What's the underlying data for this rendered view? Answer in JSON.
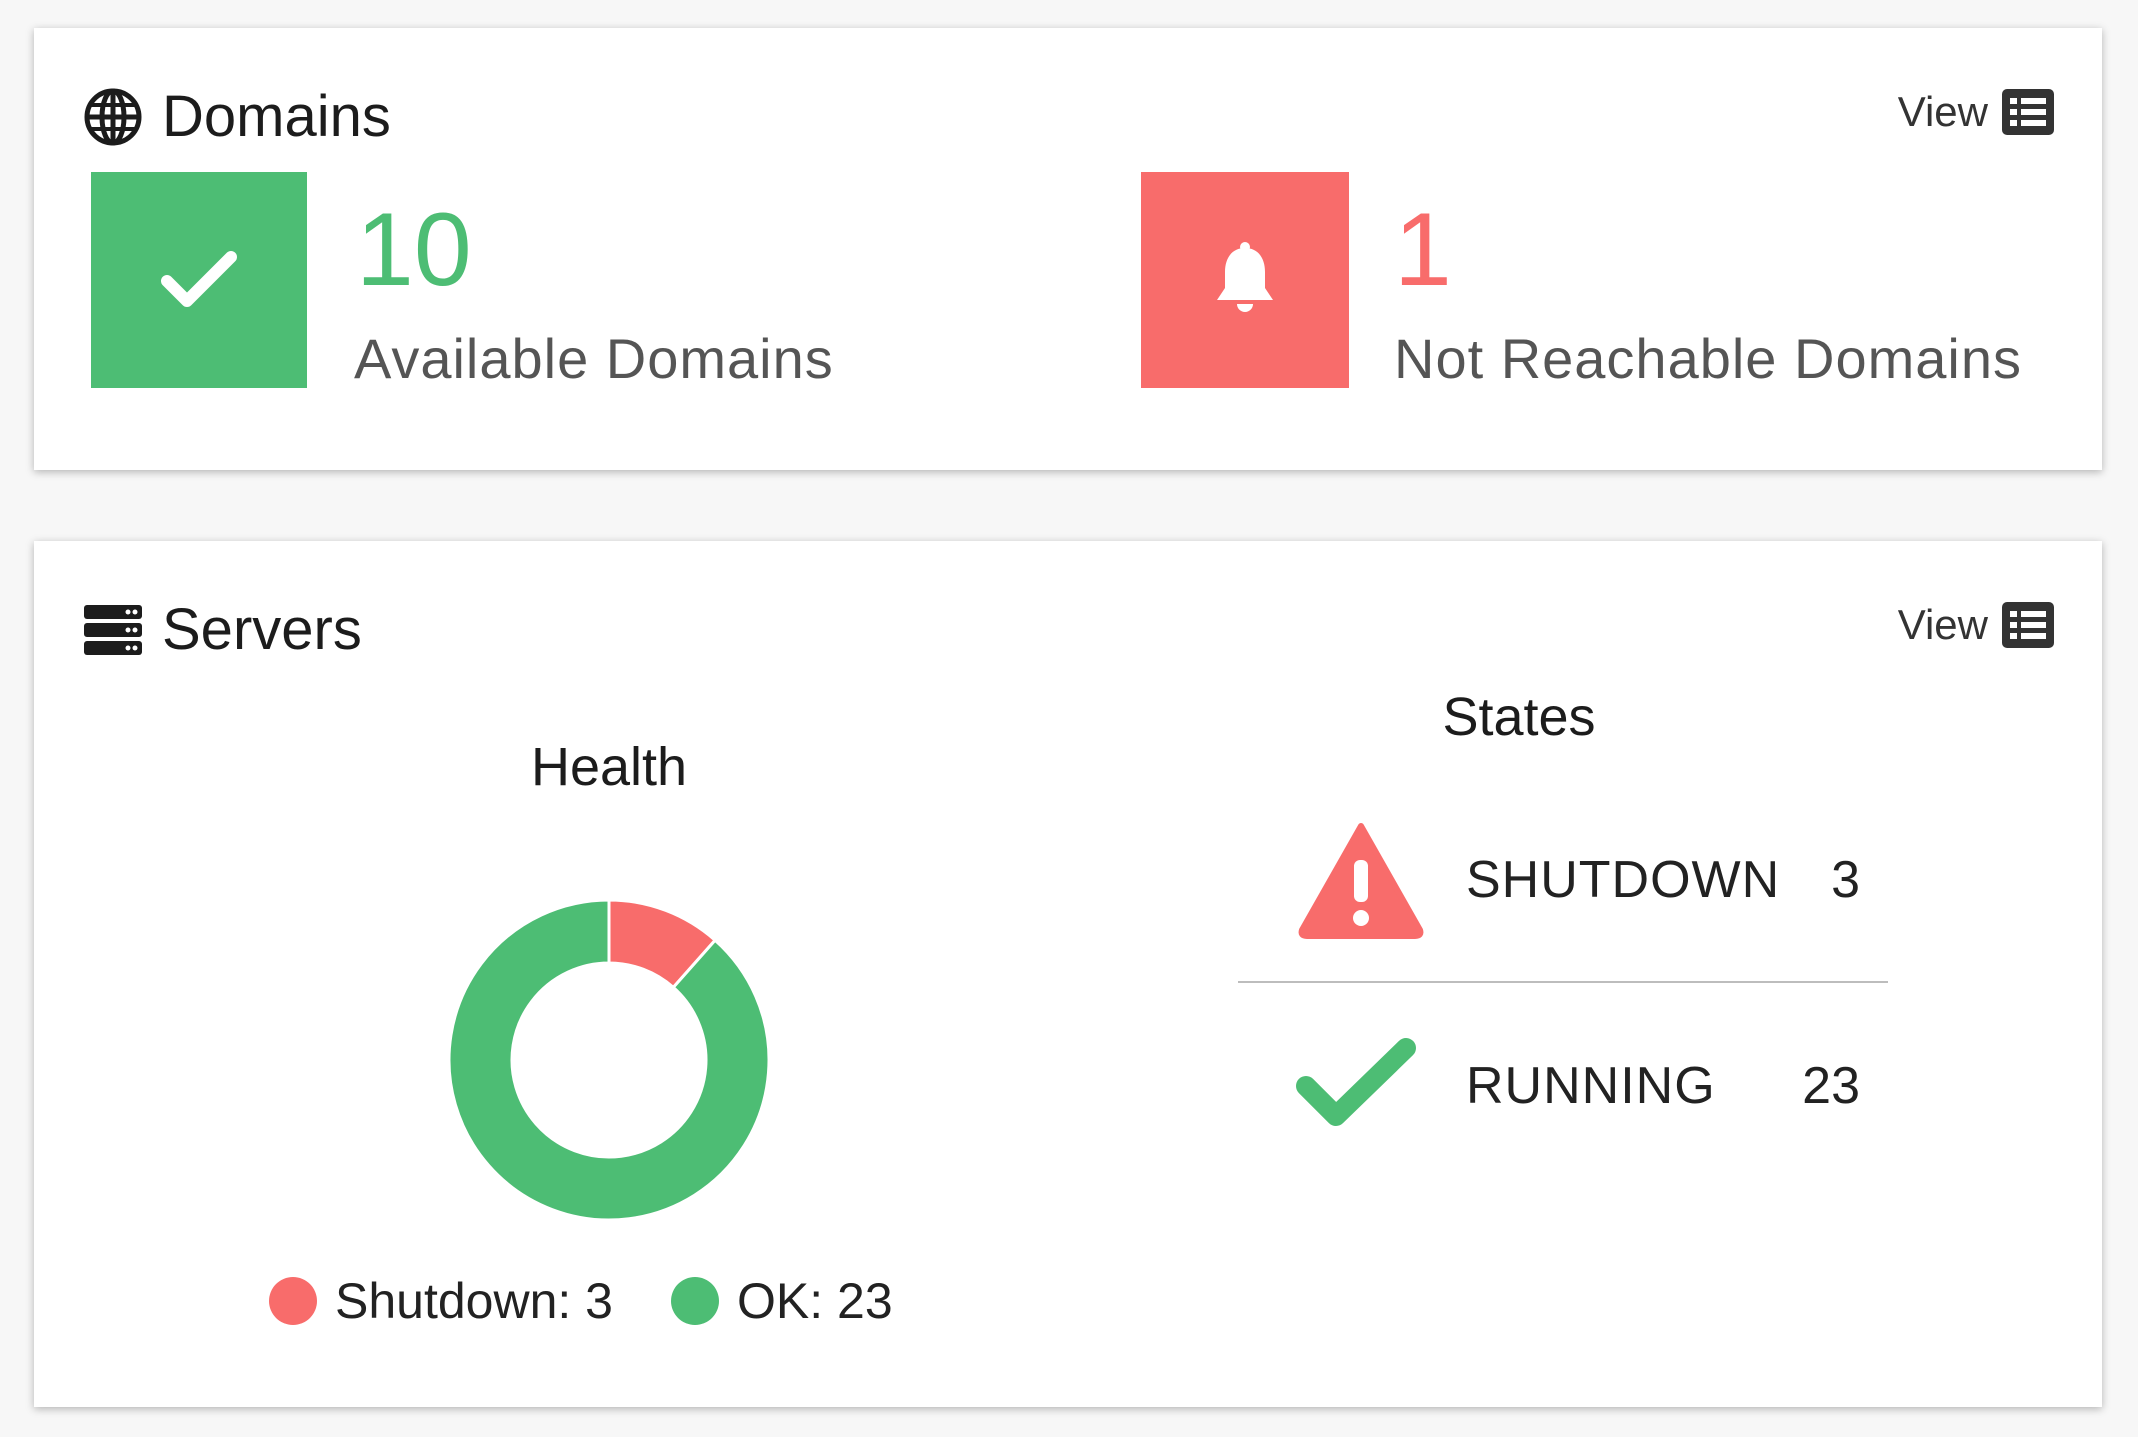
{
  "domains": {
    "title": "Domains",
    "view_label": "View",
    "available": {
      "count": "10",
      "label": "Available Domains"
    },
    "unreachable": {
      "count": "1",
      "label": "Not Reachable Domains"
    }
  },
  "servers": {
    "title": "Servers",
    "view_label": "View",
    "health": {
      "title": "Health",
      "legend": [
        {
          "label": "Shutdown: 3",
          "color": "#f86c6b"
        },
        {
          "label": "OK: 23",
          "color": "#4dbd74"
        }
      ]
    },
    "states": {
      "title": "States",
      "rows": [
        {
          "name": "SHUTDOWN",
          "count": "3",
          "icon": "warning-triangle-icon"
        },
        {
          "name": "RUNNING",
          "count": "23",
          "icon": "checkmark-icon"
        }
      ]
    }
  },
  "chart_data": {
    "type": "pie",
    "title": "Health",
    "categories": [
      "Shutdown",
      "OK"
    ],
    "values": [
      3,
      23
    ],
    "colors": [
      "#f86c6b",
      "#4dbd74"
    ],
    "donut": true,
    "legend": "bottom"
  },
  "colors": {
    "success": "#4dbd74",
    "danger": "#f86c6b"
  }
}
